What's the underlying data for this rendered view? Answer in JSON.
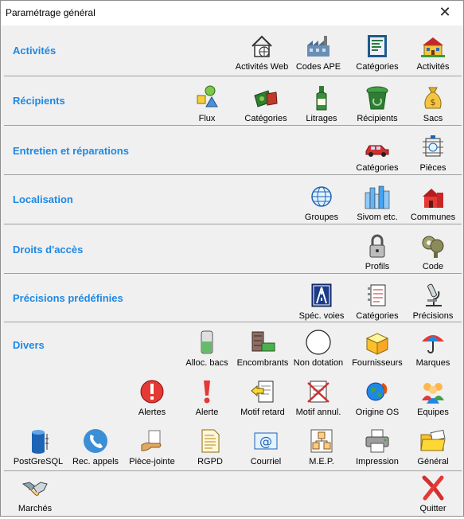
{
  "window": {
    "title": "Paramétrage général",
    "close_glyph": "✕"
  },
  "sections": {
    "activites": {
      "label": "Activités",
      "items": [
        "Activités Web",
        "Codes APE",
        "Catégories",
        "Activités"
      ]
    },
    "recipients": {
      "label": "Récipients",
      "items": [
        "Flux",
        "Catégories",
        "Litrages",
        "Récipients",
        "Sacs"
      ]
    },
    "entretien": {
      "label": "Entretien et réparations",
      "items": [
        "Catégories",
        "Pièces"
      ]
    },
    "localisation": {
      "label": "Localisation",
      "items": [
        "Groupes",
        "Sivom etc.",
        "Communes"
      ]
    },
    "droits": {
      "label": "Droits d'accès",
      "items": [
        "Profils",
        "Code"
      ]
    },
    "precisions": {
      "label": "Précisions prédéfinies",
      "items": [
        "Spéc. voies",
        "Catégories",
        "Précisions"
      ]
    },
    "divers": {
      "label": "Divers",
      "row1": [
        "Alloc. bacs",
        "Encombrants",
        "Non dotation",
        "Fournisseurs",
        "Marques"
      ],
      "row2": [
        "Alertes",
        "Alerte",
        "Motif retard",
        "Motif annul.",
        "Origine OS",
        "Equipes"
      ],
      "row3": [
        "PostGreSQL",
        "Rec. appels",
        "Pièce-jointe",
        "RGPD",
        "Courriel",
        "M.E.P.",
        "Impression",
        "Général"
      ]
    }
  },
  "footer": {
    "marches": "Marchés",
    "quitter": "Quitter"
  },
  "colors": {
    "section_label": "#1e88e5",
    "background": "#f0f0f0"
  }
}
